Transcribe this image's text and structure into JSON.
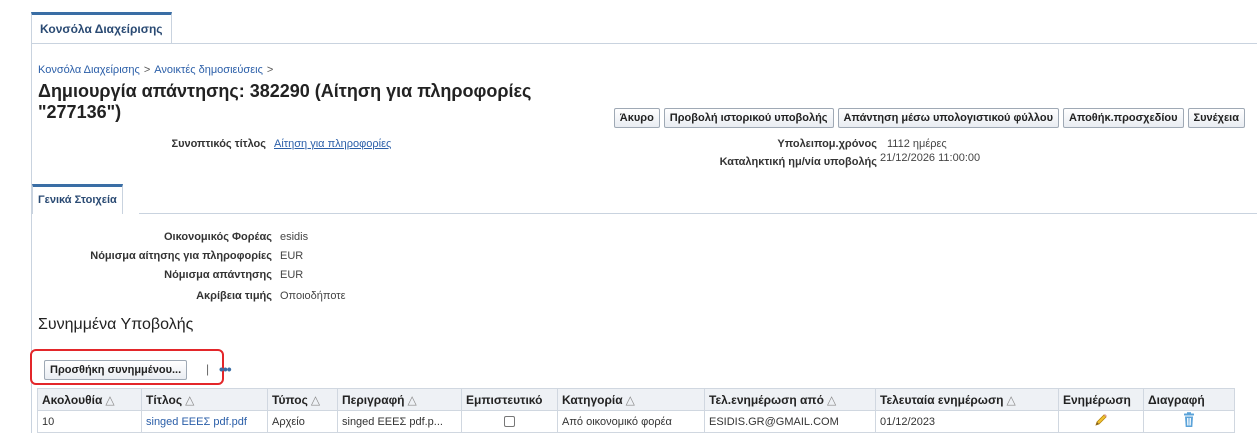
{
  "app": {
    "tab_label": "Κονσόλα Διαχείρισης"
  },
  "breadcrumb": {
    "items": [
      "Κονσόλα Διαχείρισης",
      "Ανοικτές δημοσιεύσεις"
    ],
    "separator": ">"
  },
  "page": {
    "title": "Δημιουργία απάντησης: 382290 (Αίτηση για πληροφορίες \"277136\")"
  },
  "actions": {
    "cancel": "Άκυρο",
    "history": "Προβολή ιστορικού υποβολής",
    "spreadsheet": "Απάντηση μέσω υπολογιστικού φύλλου",
    "save_draft": "Αποθήκ.προσχεδίου",
    "continue": "Συνέχεια"
  },
  "summary": {
    "short_title_label": "Συνοπτικός τίτλος",
    "short_title_value": "Αίτηση για πληροφορίες",
    "remaining_time_label": "Υπολειπομ.χρόνος",
    "remaining_time_value": "1112 ημέρες",
    "deadline_label": "Καταληκτική ημ/νία υποβολής",
    "deadline_value": "21/12/2026 11:00:00"
  },
  "general_tab": {
    "label": "Γενικά Στοιχεία",
    "fields": [
      {
        "label": "Οικονομικός Φορέας",
        "value": "esidis"
      },
      {
        "label": "Νόμισμα αίτησης για πληροφορίες",
        "value": "EUR"
      },
      {
        "label": "Νόμισμα απάντησης",
        "value": "EUR"
      },
      {
        "label": "Ακρίβεια τιμής",
        "value": "Οποιοδήποτε"
      }
    ]
  },
  "attachments": {
    "section_title": "Συνημμένα Υποβολής",
    "add_button": "Προσθήκη συνημμένου...",
    "divider": "|",
    "more_icon": "•••",
    "columns": [
      "Ακολουθία",
      "Τίτλος",
      "Τύπος",
      "Περιγραφή",
      "Εμπιστευτικό",
      "Κατηγορία",
      "Τελ.ενημέρωση από",
      "Τελευταία ενημέρωση",
      "Ενημέρωση",
      "Διαγραφή"
    ],
    "sort_indicator": "△",
    "rows": [
      {
        "sequence": "10",
        "title": "singed ΕΕΕΣ pdf.pdf",
        "type": "Αρχείο",
        "description": "singed ΕΕΕΣ pdf.p...",
        "confidential": false,
        "category": "Από οικονομικό φορέα",
        "updated_by": "ESIDIS.GR@GMAIL.COM",
        "last_updated": "01/12/2023",
        "update_icon": "pencil-icon",
        "delete_icon": "trash-icon"
      }
    ]
  },
  "colors": {
    "link": "#2a5ea8",
    "tab_accent": "#3a6ea5",
    "highlight": "#e3262a"
  }
}
